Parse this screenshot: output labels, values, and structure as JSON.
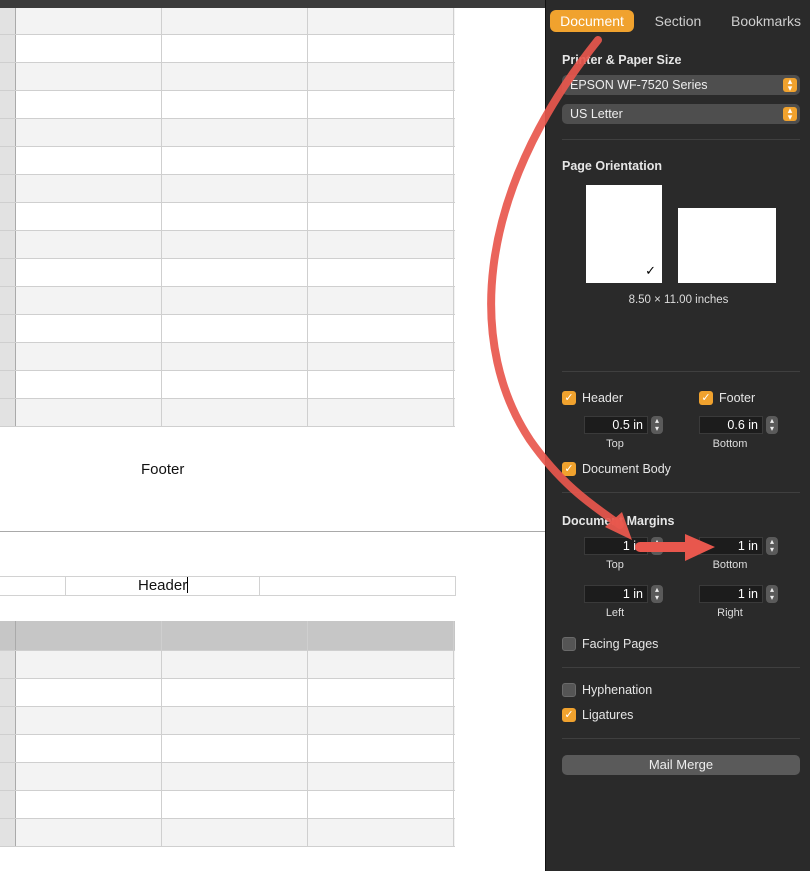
{
  "sidebar": {
    "tabs": [
      "Document",
      "Section",
      "Bookmarks"
    ],
    "printer_paper": {
      "title": "Printer & Paper Size",
      "printer": "EPSON WF-7520 Series",
      "paper": "US Letter"
    },
    "orientation": {
      "title": "Page Orientation",
      "size_label": "8.50 × 11.00 inches"
    },
    "header_footer": {
      "header_label": "Header",
      "footer_label": "Footer",
      "header_value": "0.5 in",
      "footer_value": "0.6 in",
      "top_label": "Top",
      "bottom_label": "Bottom",
      "document_body_label": "Document Body"
    },
    "margins": {
      "title": "Document Margins",
      "top_value": "1 in",
      "bottom_value": "1 in",
      "left_value": "1 in",
      "right_value": "1 in",
      "top_label": "Top",
      "bottom_label": "Bottom",
      "left_label": "Left",
      "right_label": "Right"
    },
    "facing_pages_label": "Facing Pages",
    "hyphenation_label": "Hyphenation",
    "ligatures_label": "Ligatures",
    "mail_merge_label": "Mail Merge"
  },
  "document": {
    "footer_text": "Footer",
    "header_text": "Header"
  },
  "colors": {
    "accent": "#f0a22e",
    "annotation_arrow": "#e8574d"
  }
}
